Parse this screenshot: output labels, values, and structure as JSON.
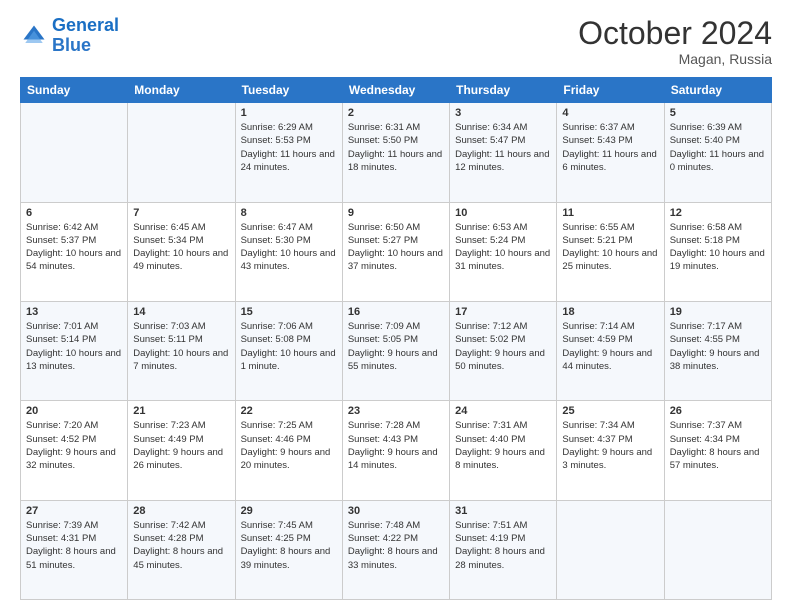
{
  "header": {
    "logo_line1": "General",
    "logo_line2": "Blue",
    "month": "October 2024",
    "location": "Magan, Russia"
  },
  "weekdays": [
    "Sunday",
    "Monday",
    "Tuesday",
    "Wednesday",
    "Thursday",
    "Friday",
    "Saturday"
  ],
  "weeks": [
    [
      {
        "day": "",
        "info": ""
      },
      {
        "day": "",
        "info": ""
      },
      {
        "day": "1",
        "info": "Sunrise: 6:29 AM\nSunset: 5:53 PM\nDaylight: 11 hours and 24 minutes."
      },
      {
        "day": "2",
        "info": "Sunrise: 6:31 AM\nSunset: 5:50 PM\nDaylight: 11 hours and 18 minutes."
      },
      {
        "day": "3",
        "info": "Sunrise: 6:34 AM\nSunset: 5:47 PM\nDaylight: 11 hours and 12 minutes."
      },
      {
        "day": "4",
        "info": "Sunrise: 6:37 AM\nSunset: 5:43 PM\nDaylight: 11 hours and 6 minutes."
      },
      {
        "day": "5",
        "info": "Sunrise: 6:39 AM\nSunset: 5:40 PM\nDaylight: 11 hours and 0 minutes."
      }
    ],
    [
      {
        "day": "6",
        "info": "Sunrise: 6:42 AM\nSunset: 5:37 PM\nDaylight: 10 hours and 54 minutes."
      },
      {
        "day": "7",
        "info": "Sunrise: 6:45 AM\nSunset: 5:34 PM\nDaylight: 10 hours and 49 minutes."
      },
      {
        "day": "8",
        "info": "Sunrise: 6:47 AM\nSunset: 5:30 PM\nDaylight: 10 hours and 43 minutes."
      },
      {
        "day": "9",
        "info": "Sunrise: 6:50 AM\nSunset: 5:27 PM\nDaylight: 10 hours and 37 minutes."
      },
      {
        "day": "10",
        "info": "Sunrise: 6:53 AM\nSunset: 5:24 PM\nDaylight: 10 hours and 31 minutes."
      },
      {
        "day": "11",
        "info": "Sunrise: 6:55 AM\nSunset: 5:21 PM\nDaylight: 10 hours and 25 minutes."
      },
      {
        "day": "12",
        "info": "Sunrise: 6:58 AM\nSunset: 5:18 PM\nDaylight: 10 hours and 19 minutes."
      }
    ],
    [
      {
        "day": "13",
        "info": "Sunrise: 7:01 AM\nSunset: 5:14 PM\nDaylight: 10 hours and 13 minutes."
      },
      {
        "day": "14",
        "info": "Sunrise: 7:03 AM\nSunset: 5:11 PM\nDaylight: 10 hours and 7 minutes."
      },
      {
        "day": "15",
        "info": "Sunrise: 7:06 AM\nSunset: 5:08 PM\nDaylight: 10 hours and 1 minute."
      },
      {
        "day": "16",
        "info": "Sunrise: 7:09 AM\nSunset: 5:05 PM\nDaylight: 9 hours and 55 minutes."
      },
      {
        "day": "17",
        "info": "Sunrise: 7:12 AM\nSunset: 5:02 PM\nDaylight: 9 hours and 50 minutes."
      },
      {
        "day": "18",
        "info": "Sunrise: 7:14 AM\nSunset: 4:59 PM\nDaylight: 9 hours and 44 minutes."
      },
      {
        "day": "19",
        "info": "Sunrise: 7:17 AM\nSunset: 4:55 PM\nDaylight: 9 hours and 38 minutes."
      }
    ],
    [
      {
        "day": "20",
        "info": "Sunrise: 7:20 AM\nSunset: 4:52 PM\nDaylight: 9 hours and 32 minutes."
      },
      {
        "day": "21",
        "info": "Sunrise: 7:23 AM\nSunset: 4:49 PM\nDaylight: 9 hours and 26 minutes."
      },
      {
        "day": "22",
        "info": "Sunrise: 7:25 AM\nSunset: 4:46 PM\nDaylight: 9 hours and 20 minutes."
      },
      {
        "day": "23",
        "info": "Sunrise: 7:28 AM\nSunset: 4:43 PM\nDaylight: 9 hours and 14 minutes."
      },
      {
        "day": "24",
        "info": "Sunrise: 7:31 AM\nSunset: 4:40 PM\nDaylight: 9 hours and 8 minutes."
      },
      {
        "day": "25",
        "info": "Sunrise: 7:34 AM\nSunset: 4:37 PM\nDaylight: 9 hours and 3 minutes."
      },
      {
        "day": "26",
        "info": "Sunrise: 7:37 AM\nSunset: 4:34 PM\nDaylight: 8 hours and 57 minutes."
      }
    ],
    [
      {
        "day": "27",
        "info": "Sunrise: 7:39 AM\nSunset: 4:31 PM\nDaylight: 8 hours and 51 minutes."
      },
      {
        "day": "28",
        "info": "Sunrise: 7:42 AM\nSunset: 4:28 PM\nDaylight: 8 hours and 45 minutes."
      },
      {
        "day": "29",
        "info": "Sunrise: 7:45 AM\nSunset: 4:25 PM\nDaylight: 8 hours and 39 minutes."
      },
      {
        "day": "30",
        "info": "Sunrise: 7:48 AM\nSunset: 4:22 PM\nDaylight: 8 hours and 33 minutes."
      },
      {
        "day": "31",
        "info": "Sunrise: 7:51 AM\nSunset: 4:19 PM\nDaylight: 8 hours and 28 minutes."
      },
      {
        "day": "",
        "info": ""
      },
      {
        "day": "",
        "info": ""
      }
    ]
  ]
}
